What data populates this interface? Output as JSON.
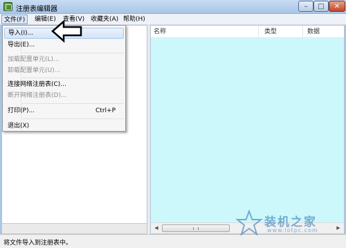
{
  "window": {
    "title": "注册表编辑器",
    "controls": [
      "minimize-icon",
      "maximize-icon",
      "close-icon"
    ]
  },
  "menubar": {
    "items": [
      {
        "label": "文件(F)",
        "active": true
      },
      {
        "label": "编辑(E)"
      },
      {
        "label": "查看(V)"
      },
      {
        "label": "收藏夹(A)"
      },
      {
        "label": "帮助(H)"
      }
    ]
  },
  "file_menu": {
    "items": [
      {
        "label": "导入(I)...",
        "highlighted": true
      },
      {
        "label": "导出(E)..."
      },
      {
        "label": "加载配置单元(L)...",
        "disabled": true
      },
      {
        "label": "卸载配置单元(U)...",
        "disabled": true
      },
      {
        "label": "连接网络注册表(C)..."
      },
      {
        "label": "断开网络注册表(D)...",
        "disabled": true
      },
      {
        "label": "打印(P)...",
        "shortcut": "Ctrl+P"
      },
      {
        "label": "退出(X)"
      }
    ]
  },
  "list": {
    "columns": [
      "名称",
      "类型",
      "数据"
    ],
    "background_color": "#ccf8fb"
  },
  "statusbar": {
    "text": "将文件导入到注册表中。"
  },
  "watermark": {
    "cn": "装机之家",
    "en": "www.lotpc.com"
  },
  "annotation": {
    "icon": "arrow-left-icon"
  }
}
